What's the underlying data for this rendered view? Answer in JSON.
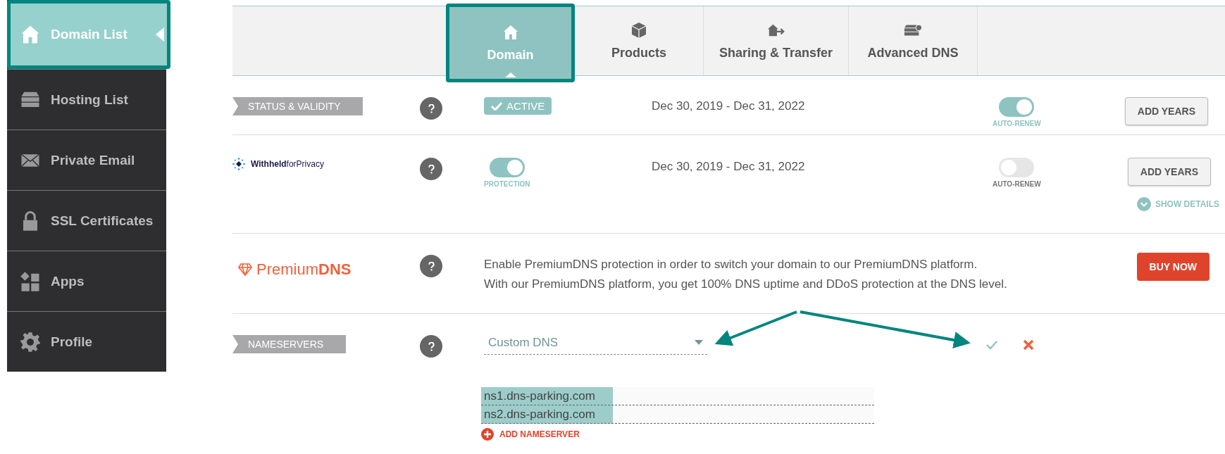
{
  "sidebar": {
    "items": [
      {
        "label": "Domain List",
        "selected": true
      },
      {
        "label": "Hosting List",
        "selected": false
      },
      {
        "label": "Private Email",
        "selected": false
      },
      {
        "label": "SSL Certificates",
        "selected": false
      },
      {
        "label": "Apps",
        "selected": false
      },
      {
        "label": "Profile",
        "selected": false
      }
    ]
  },
  "tabs": [
    {
      "label": "Domain",
      "selected": true
    },
    {
      "label": "Products",
      "selected": false
    },
    {
      "label": "Sharing & Transfer",
      "selected": false
    },
    {
      "label": "Advanced DNS",
      "selected": false
    }
  ],
  "status": {
    "label": "STATUS & VALIDITY",
    "badge": "ACTIVE",
    "dates": "Dec 30, 2019 - Dec 31, 2022",
    "auto_renew": {
      "label": "AUTO-RENEW",
      "on": true
    },
    "button": "ADD YEARS"
  },
  "privacy": {
    "logo": "**Withheld**forPrivacy",
    "protection": {
      "label": "PROTECTION",
      "on": true
    },
    "dates": "Dec 30, 2019 - Dec 31, 2022",
    "auto_renew": {
      "label": "AUTO-RENEW",
      "on": false
    },
    "button": "ADD YEARS",
    "details_link": "SHOW DETAILS"
  },
  "premium_dns": {
    "logo": "Premium**DNS**",
    "lines": [
      "Enable PremiumDNS protection in order to switch your domain to our PremiumDNS platform.",
      "With our PremiumDNS platform, you get 100% DNS uptime and DDoS protection at the DNS level."
    ],
    "button": "BUY NOW"
  },
  "nameservers": {
    "label": "NAMESERVERS",
    "dropdown": "Custom DNS",
    "entries": [
      {
        "value": "ns1.dns-parking.com",
        "selected": true
      },
      {
        "value": "ns2.dns-parking.com",
        "selected": true
      }
    ],
    "add_label": "ADD NAMESERVER"
  }
}
